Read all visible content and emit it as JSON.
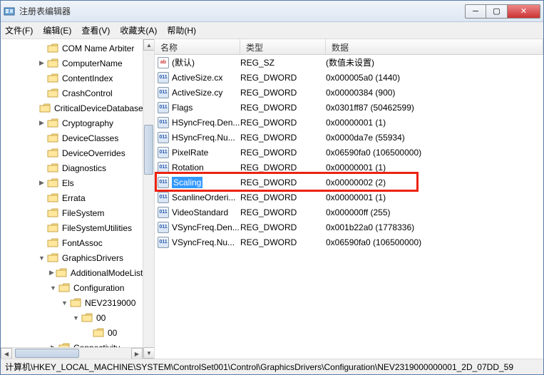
{
  "window": {
    "title": "注册表编辑器"
  },
  "menu": {
    "file": "文件(F)",
    "edit": "编辑(E)",
    "view": "查看(V)",
    "favorites": "收藏夹(A)",
    "help": "帮助(H)"
  },
  "columns": {
    "name": "名称",
    "type": "类型",
    "data": "数据"
  },
  "tree": [
    {
      "indent": 3,
      "exp": "",
      "label": "COM Name Arbiter"
    },
    {
      "indent": 3,
      "exp": "▶",
      "label": "ComputerName"
    },
    {
      "indent": 3,
      "exp": "",
      "label": "ContentIndex"
    },
    {
      "indent": 3,
      "exp": "",
      "label": "CrashControl"
    },
    {
      "indent": 3,
      "exp": "",
      "label": "CriticalDeviceDatabase"
    },
    {
      "indent": 3,
      "exp": "▶",
      "label": "Cryptography"
    },
    {
      "indent": 3,
      "exp": "",
      "label": "DeviceClasses"
    },
    {
      "indent": 3,
      "exp": "",
      "label": "DeviceOverrides"
    },
    {
      "indent": 3,
      "exp": "",
      "label": "Diagnostics"
    },
    {
      "indent": 3,
      "exp": "▶",
      "label": "Els"
    },
    {
      "indent": 3,
      "exp": "",
      "label": "Errata"
    },
    {
      "indent": 3,
      "exp": "",
      "label": "FileSystem"
    },
    {
      "indent": 3,
      "exp": "",
      "label": "FileSystemUtilities"
    },
    {
      "indent": 3,
      "exp": "",
      "label": "FontAssoc"
    },
    {
      "indent": 3,
      "exp": "▼",
      "label": "GraphicsDrivers"
    },
    {
      "indent": 4,
      "exp": "▶",
      "label": "AdditionalModeLists"
    },
    {
      "indent": 4,
      "exp": "▼",
      "label": "Configuration"
    },
    {
      "indent": 5,
      "exp": "▼",
      "label": "NEV2319000"
    },
    {
      "indent": 6,
      "exp": "▼",
      "label": "00"
    },
    {
      "indent": 7,
      "exp": "",
      "label": "00"
    },
    {
      "indent": 4,
      "exp": "▶",
      "label": "Connectivity"
    }
  ],
  "values": [
    {
      "icon": "sz",
      "name": "(默认)",
      "type": "REG_SZ",
      "data": "(数值未设置)"
    },
    {
      "icon": "dw",
      "name": "ActiveSize.cx",
      "type": "REG_DWORD",
      "data": "0x000005a0 (1440)"
    },
    {
      "icon": "dw",
      "name": "ActiveSize.cy",
      "type": "REG_DWORD",
      "data": "0x00000384 (900)"
    },
    {
      "icon": "dw",
      "name": "Flags",
      "type": "REG_DWORD",
      "data": "0x0301ff87 (50462599)"
    },
    {
      "icon": "dw",
      "name": "HSyncFreq.Den...",
      "type": "REG_DWORD",
      "data": "0x00000001 (1)"
    },
    {
      "icon": "dw",
      "name": "HSyncFreq.Nu...",
      "type": "REG_DWORD",
      "data": "0x0000da7e (55934)"
    },
    {
      "icon": "dw",
      "name": "PixelRate",
      "type": "REG_DWORD",
      "data": "0x06590fa0 (106500000)"
    },
    {
      "icon": "dw",
      "name": "Rotation",
      "type": "REG_DWORD",
      "data": "0x00000001 (1)"
    },
    {
      "icon": "dw",
      "name": "Scaling",
      "type": "REG_DWORD",
      "data": "0x00000002 (2)",
      "selected": true
    },
    {
      "icon": "dw",
      "name": "ScanlineOrderi...",
      "type": "REG_DWORD",
      "data": "0x00000001 (1)"
    },
    {
      "icon": "dw",
      "name": "VideoStandard",
      "type": "REG_DWORD",
      "data": "0x000000ff (255)"
    },
    {
      "icon": "dw",
      "name": "VSyncFreq.Den...",
      "type": "REG_DWORD",
      "data": "0x001b22a0 (1778336)"
    },
    {
      "icon": "dw",
      "name": "VSyncFreq.Nu...",
      "type": "REG_DWORD",
      "data": "0x06590fa0 (106500000)"
    }
  ],
  "status": {
    "path": "计算机\\HKEY_LOCAL_MACHINE\\SYSTEM\\ControlSet001\\Control\\GraphicsDrivers\\Configuration\\NEV2319000000001_2D_07DD_59"
  },
  "icon_text": {
    "sz": "ab",
    "dw": "011"
  }
}
